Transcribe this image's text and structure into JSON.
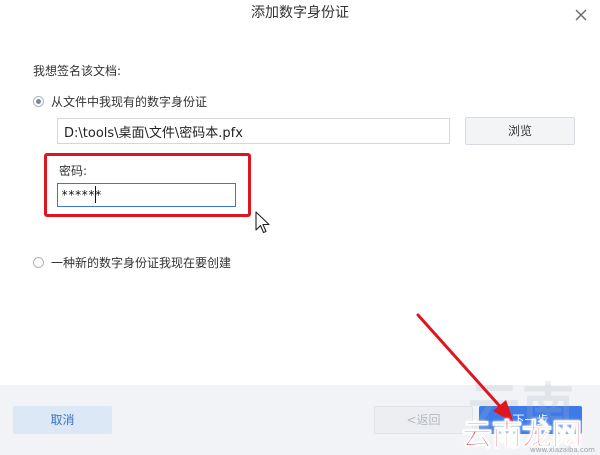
{
  "dialog": {
    "title": "添加数字身份证",
    "prompt": "我想签名该文档:",
    "options": [
      {
        "label": "从文件中我现有的数字身份证",
        "selected": true
      },
      {
        "label": "一种新的数字身份证我现在要创建",
        "selected": false
      }
    ],
    "file_path": "D:\\tools\\桌面\\文件\\密码本.pfx",
    "browse_label": "浏览",
    "password_label": "密码:",
    "password_value": "******"
  },
  "footer": {
    "cancel_label": "取消",
    "back_label": "<返回",
    "next_label": "下一步"
  },
  "watermark": {
    "bg_text": "云南",
    "text": "云南龙网",
    "url": "www.xiazaiba.com"
  },
  "colors": {
    "accent": "#3f7be8",
    "annotation_red": "#e0161e"
  }
}
